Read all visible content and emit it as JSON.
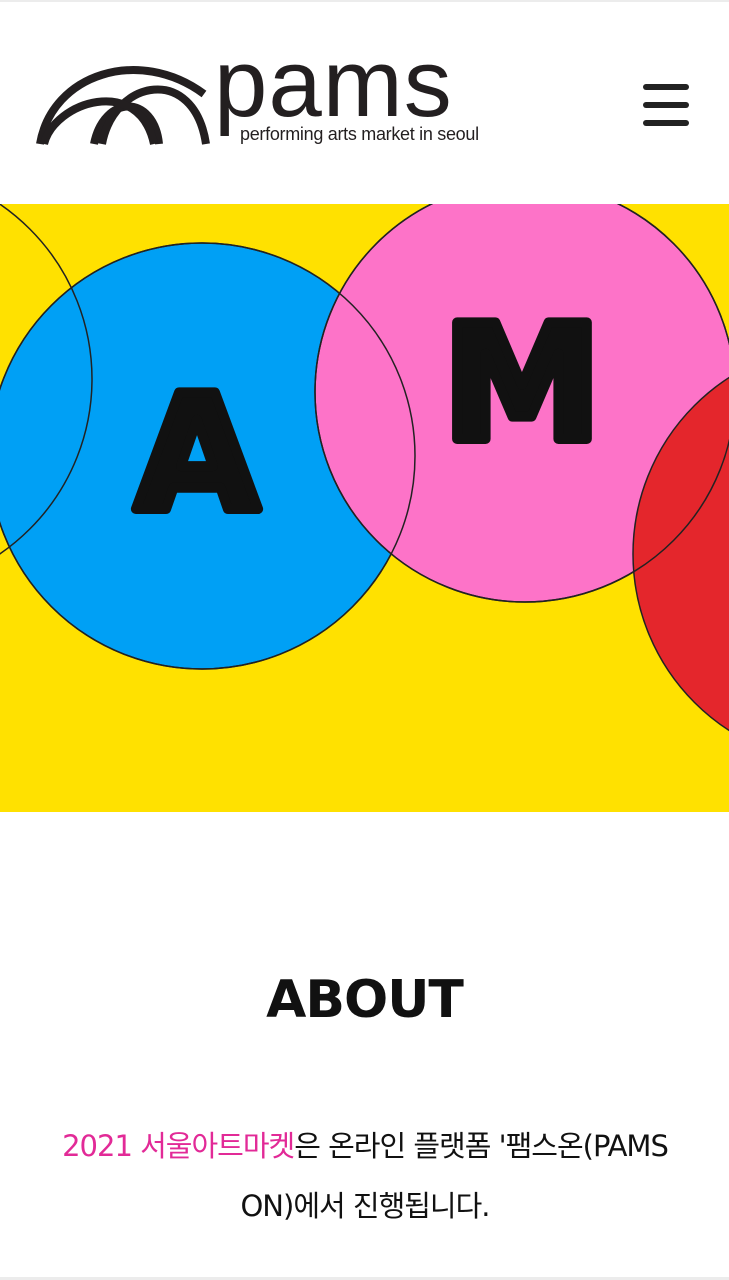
{
  "colors": {
    "background": "#ffffff",
    "hero_yellow": "#ffe100",
    "circle_blue": "#00a0f5",
    "circle_pink": "#fd73c8",
    "circle_red": "#e4262c",
    "accent_pink": "#e22a97",
    "text_dark": "#111111"
  },
  "header": {
    "logo": {
      "word": "pams",
      "tagline": "performing arts market in seoul",
      "mark_icon": "arches-logo-icon"
    },
    "menu_icon": "hamburger-menu-icon"
  },
  "hero": {
    "letters": [
      "A",
      "M"
    ]
  },
  "about": {
    "title": "ABOUT",
    "highlight": "2021 서울아트마켓",
    "text_part1": "은 온라인 플랫폼 '팸스온(PAMS",
    "text_part2": "ON)에서 진행됩니다."
  }
}
